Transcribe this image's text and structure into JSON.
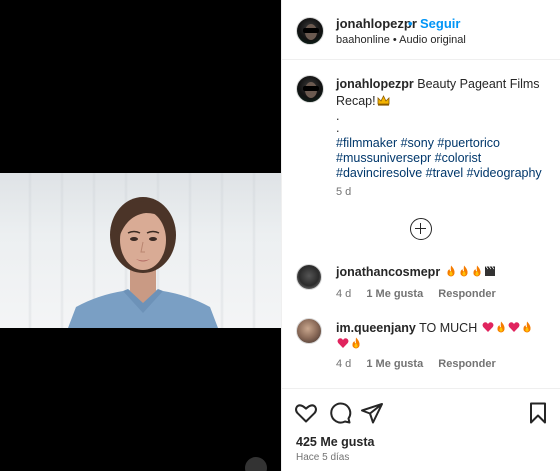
{
  "header": {
    "username": "jonahlopezpr",
    "separator": "•",
    "follow_label": "Seguir",
    "subtitle": "baahonline • Audio original"
  },
  "caption": {
    "username": "jonahlopezpr",
    "text": "Beauty Pageant Films Recap!",
    "dot1": ".",
    "dot2": ".",
    "hashtags_line1": "#filmmaker #sony #puertorico",
    "hashtags_line2": "#mussuniversepr #colorist",
    "hashtags_line3": "#davinciresolve #travel #videography",
    "time": "5 d"
  },
  "comments": [
    {
      "username": "jonathancosmepr",
      "text": "",
      "age": "4 d",
      "likes": "1 Me gusta",
      "reply": "Responder"
    },
    {
      "username": "im.queenjany",
      "text": "TO MUCH",
      "age": "4 d",
      "likes": "1 Me gusta",
      "reply": "Responder"
    }
  ],
  "footer": {
    "likes": "425 Me gusta",
    "date": "Hace 5 días"
  },
  "colors": {
    "accent": "#0095f6",
    "hashtag": "#00376b",
    "secondary_text": "#737373"
  }
}
